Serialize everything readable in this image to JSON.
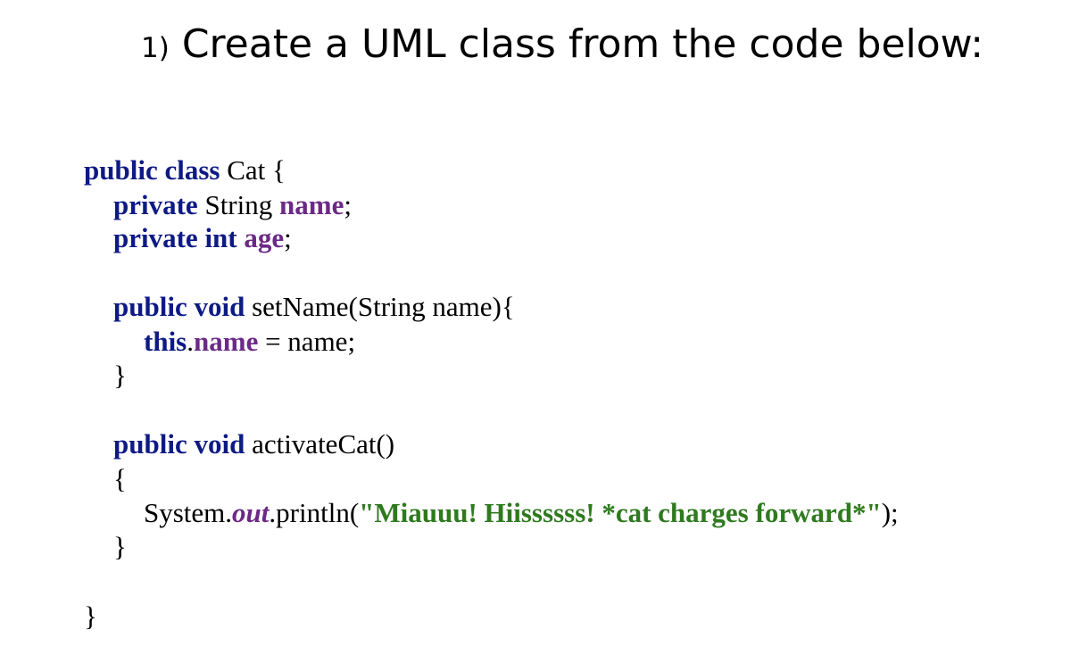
{
  "heading": {
    "number": "1)",
    "text": "Create a UML class from the code below:"
  },
  "code": {
    "class_decl": {
      "kw": "public class",
      "rest": " Cat {"
    },
    "field_name": {
      "kw": "private",
      "type": " String ",
      "name": "name",
      "end": ";"
    },
    "field_age": {
      "kw": "private int",
      "sp": " ",
      "name": "age",
      "end": ";"
    },
    "setname_sig": {
      "kw": "public void",
      "rest": " setName(String name){"
    },
    "setname_body": {
      "kw": "this",
      "dot": ".",
      "field": "name",
      "rest": " = name;"
    },
    "setname_close": "}",
    "activate_sig": {
      "kw": "public void",
      "rest": " activateCat()"
    },
    "activate_open": "{",
    "activate_body": {
      "obj": "System.",
      "out": "out",
      "call": ".println(",
      "str": "\"Miauuu! Hiissssss! *cat charges forward*\"",
      "end": ");"
    },
    "activate_close": "}",
    "class_close": "}"
  },
  "colors": {
    "keyword": "#0e1a84",
    "field": "#6b2a86",
    "string": "#2f7a1f"
  }
}
